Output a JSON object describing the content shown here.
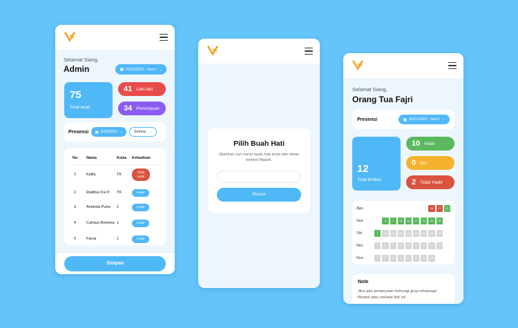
{
  "colors": {
    "accent": "#4fb8f7",
    "red": "#e94b4b",
    "purple": "#8a5cf0",
    "green": "#5cb85c",
    "orange": "#f7b22d",
    "tomato": "#d9533f"
  },
  "admin": {
    "greeting": "Selamat Siang,",
    "name": "Admin",
    "period": "2021/2022 - Sem I",
    "total_value": "75",
    "total_label": "Total anak",
    "male_value": "41",
    "male_label": "Laki-laki",
    "female_value": "34",
    "female_label": "Perempuan",
    "presensi_label": "Presensi",
    "date": "6/10/2021",
    "filter": "Semua",
    "headers": [
      "No",
      "Nama",
      "Kelas",
      "Kehadiran"
    ],
    "rows": [
      {
        "no": "1",
        "nama": "Kailla",
        "kelas": "TK",
        "status": "Tidak Hadir"
      },
      {
        "no": "2",
        "nama": "Raditya Ovi P.",
        "kelas": "TK",
        "status": "Hadir"
      },
      {
        "no": "3",
        "nama": "Andesta Putra",
        "kelas": "1",
        "status": "Hadir"
      },
      {
        "no": "4",
        "nama": "Cahaya Reviona",
        "kelas": "1",
        "status": "Hadir"
      },
      {
        "no": "5",
        "nama": "Faruq",
        "kelas": "1",
        "status": "Hadir"
      }
    ],
    "save_label": "Simpan"
  },
  "pick": {
    "title": "Pilih Buah Hati",
    "desc": "Silahkan cari nama buah hati anda dan tekan tombol Masuk.",
    "input_placeholder": "",
    "button": "Masuk"
  },
  "parent": {
    "greeting": "Selamat Siang,",
    "name": "Orang Tua Fajri",
    "presensi_label": "Presensi",
    "period": "2021/2022 - Sem I",
    "total_value": "12",
    "total_label": "Total bimbel",
    "hadir_value": "10",
    "hadir_label": "Hadir",
    "izin_value": "0",
    "izin_label": "Izin",
    "tidak_value": "2",
    "tidak_label": "Tidak Hadir",
    "calendar": [
      {
        "month": "Agu",
        "cells": [
          [
            "",
            ""
          ],
          [
            "",
            ""
          ],
          [
            "",
            ""
          ],
          [
            "",
            ""
          ],
          [
            "",
            ""
          ],
          [
            "",
            ""
          ],
          [
            "",
            ""
          ],
          [
            "24",
            "r"
          ],
          [
            "27",
            "r"
          ],
          [
            "31",
            "g"
          ]
        ]
      },
      {
        "month": "Sep",
        "cells": [
          [
            "",
            ""
          ],
          [
            "2",
            "g"
          ],
          [
            "7",
            "g"
          ],
          [
            "10",
            "g"
          ],
          [
            "14",
            "g"
          ],
          [
            "17",
            "g"
          ],
          [
            "21",
            "g"
          ],
          [
            "24",
            "g"
          ],
          [
            "28",
            "g"
          ],
          [
            "",
            ""
          ]
        ]
      },
      {
        "month": "Okt",
        "cells": [
          [
            "1",
            "g"
          ],
          [
            "5",
            "x"
          ],
          [
            "8",
            "x"
          ],
          [
            "12",
            "x"
          ],
          [
            "15",
            "x"
          ],
          [
            "19",
            "x"
          ],
          [
            "22",
            "x"
          ],
          [
            "26",
            "x"
          ],
          [
            "29",
            "x"
          ],
          [
            "",
            ""
          ]
        ]
      },
      {
        "month": "Nov",
        "cells": [
          [
            "2",
            "x"
          ],
          [
            "5",
            "x"
          ],
          [
            "9",
            "x"
          ],
          [
            "12",
            "x"
          ],
          [
            "16",
            "x"
          ],
          [
            "19",
            "x"
          ],
          [
            "23",
            "x"
          ],
          [
            "26",
            "x"
          ],
          [
            "30",
            "x"
          ],
          [
            "",
            ""
          ]
        ]
      },
      {
        "month": "Des",
        "cells": [
          [
            "3",
            "x"
          ],
          [
            "7",
            "x"
          ],
          [
            "10",
            "x"
          ],
          [
            "14",
            "x"
          ],
          [
            "17",
            "x"
          ],
          [
            "21",
            "x"
          ],
          [
            "24",
            "x"
          ],
          [
            "28",
            "x"
          ],
          [
            "",
            ""
          ],
          [
            "",
            ""
          ]
        ]
      }
    ],
    "note_title": "Note",
    "note_text": "Jika ada pertanyaan hubungi grup whatsapp Bimbel atau melalui link ini!"
  }
}
